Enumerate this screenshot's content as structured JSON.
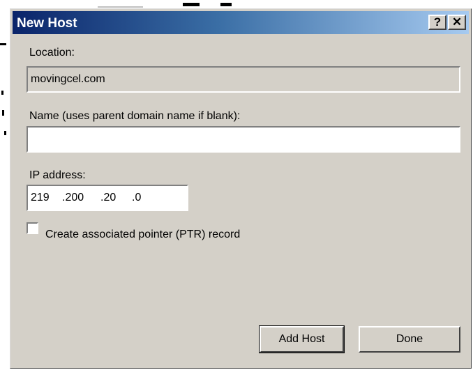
{
  "dialog": {
    "title": "New Host",
    "help_button": "?",
    "close_button": "✕"
  },
  "location": {
    "label": "Location:",
    "value": "movingcel.com"
  },
  "name": {
    "label": "Name (uses parent domain name if blank):",
    "value": ""
  },
  "ip": {
    "label": "IP address:",
    "octets": [
      "219",
      ".200",
      ".20",
      ".0"
    ]
  },
  "ptr": {
    "label": "Create associated pointer (PTR) record",
    "checked": false
  },
  "buttons": {
    "add_host": "Add Host",
    "done": "Done"
  }
}
